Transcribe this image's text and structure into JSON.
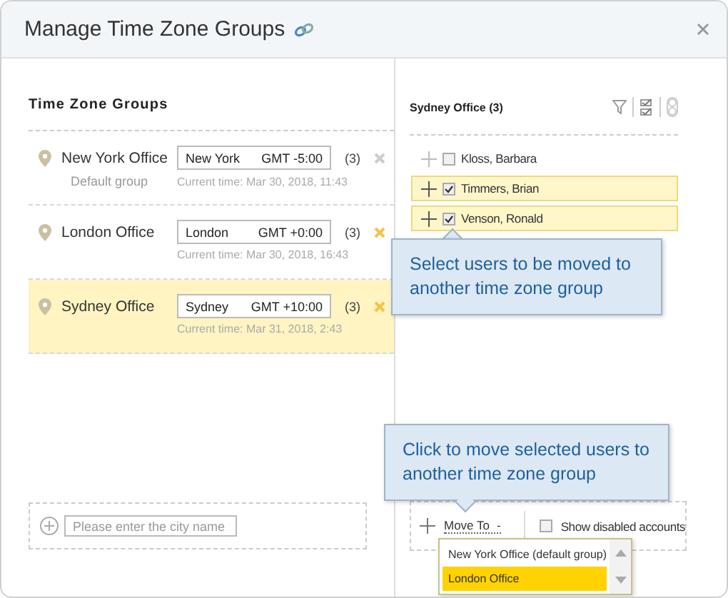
{
  "dialog": {
    "title": "Manage Time Zone Groups"
  },
  "groups_panel": {
    "title": "Time Zone Groups",
    "groups": [
      {
        "name": "New York Office",
        "note": "Default group",
        "city": "New York",
        "offset": "GMT -5:00",
        "count": "(3)",
        "current_time": "Current time: Mar 30, 2018, 11:43",
        "selected": false,
        "deletable": false
      },
      {
        "name": "London Office",
        "city": "London",
        "offset": "GMT +0:00",
        "count": "(3)",
        "current_time": "Current time: Mar 30, 2018, 16:43",
        "selected": false,
        "deletable": true
      },
      {
        "name": "Sydney Office",
        "city": "Sydney",
        "offset": "GMT +10:00",
        "count": "(3)",
        "current_time": "Current time: Mar 31, 2018, 2:43",
        "selected": true,
        "deletable": true
      }
    ],
    "add_city": {
      "placeholder": "Please enter the city name"
    }
  },
  "users_panel": {
    "title": "Sydney Office (3)",
    "users": [
      {
        "name": "Kloss, Barbara",
        "checked": false
      },
      {
        "name": "Timmers, Brian",
        "checked": true
      },
      {
        "name": "Venson, Ronald",
        "checked": true
      }
    ],
    "move_to": {
      "label": "Move To",
      "caret": "-",
      "options": [
        {
          "label": "New York Office (default group)",
          "selected": false
        },
        {
          "label": "London Office",
          "selected": true
        }
      ]
    },
    "show_disabled": {
      "label": "Show disabled accounts",
      "checked": false
    }
  },
  "tooltips": [
    {
      "text": "Select users to be moved to another time zone group"
    },
    {
      "text": "Click to move selected users to another time zone group"
    }
  ]
}
